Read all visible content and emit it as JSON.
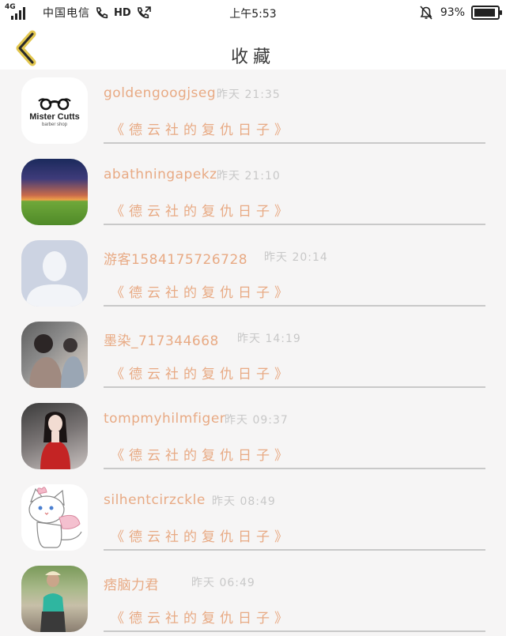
{
  "status_bar": {
    "network": "4G",
    "carrier": "中国电信",
    "hd_label": "HD",
    "time": "上午5:53",
    "battery": "93%",
    "battery_level": 0.93
  },
  "header": {
    "title": "收藏"
  },
  "items": [
    {
      "name": "goldengoogjseg",
      "time": "昨天 21:35",
      "title": "《德云社的复仇日子》",
      "avatar": {
        "brand": "Mister Cutts",
        "sub": "barber shop"
      }
    },
    {
      "name": "abathningapekz",
      "time": "昨天 21:10",
      "title": "《德云社的复仇日子》"
    },
    {
      "name": "游客1584175726728",
      "time": "昨天 20:14",
      "title": "《德云社的复仇日子》"
    },
    {
      "name": "墨染_717344668",
      "time": "昨天 14:19",
      "title": "《德云社的复仇日子》"
    },
    {
      "name": "tompmyhilmfiger",
      "time": "昨天 09:37",
      "title": "《德云社的复仇日子》"
    },
    {
      "name": "silhentcirzckle",
      "time": "昨天 08:49",
      "title": "《德云社的复仇日子》"
    },
    {
      "name": "痞脑力君",
      "time": "昨天 06:49",
      "title": "《德云社的复仇日子》"
    }
  ]
}
